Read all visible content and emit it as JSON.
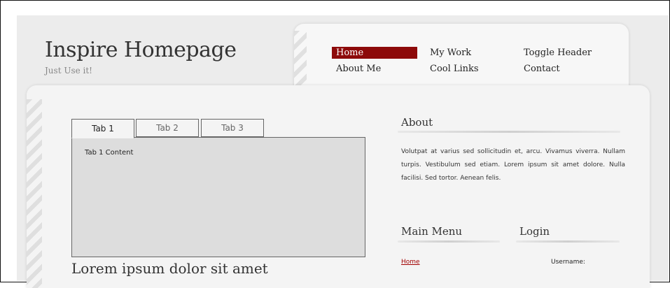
{
  "header": {
    "title": "Inspire Homepage",
    "subtitle": "Just Use it!"
  },
  "nav": {
    "items": [
      {
        "label": "Home",
        "active": true
      },
      {
        "label": "My Work",
        "active": false
      },
      {
        "label": "Toggle Header",
        "active": false
      },
      {
        "label": "About Me",
        "active": false
      },
      {
        "label": "Cool Links",
        "active": false
      },
      {
        "label": "Contact",
        "active": false
      }
    ]
  },
  "tabs": {
    "items": [
      {
        "label": "Tab 1",
        "active": true
      },
      {
        "label": "Tab 2",
        "active": false
      },
      {
        "label": "Tab 3",
        "active": false
      }
    ],
    "content": "Tab 1 Content"
  },
  "main": {
    "heading": "Lorem ipsum dolor sit amet"
  },
  "about": {
    "title": "About",
    "text": "Volutpat at varius sed sollicitudin et, arcu. Vivamus viverra. Nullam turpis. Vestibulum sed etiam. Lorem ipsum sit amet dolore. Nulla facilisi. Sed tortor. Aenean felis."
  },
  "main_menu": {
    "title": "Main Menu",
    "items": [
      {
        "label": "Home"
      }
    ]
  },
  "login": {
    "title": "Login",
    "username_label": "Username:"
  },
  "colors": {
    "accent": "#8d0a0a",
    "link": "#a00000",
    "panel": "#f4f4f4"
  }
}
